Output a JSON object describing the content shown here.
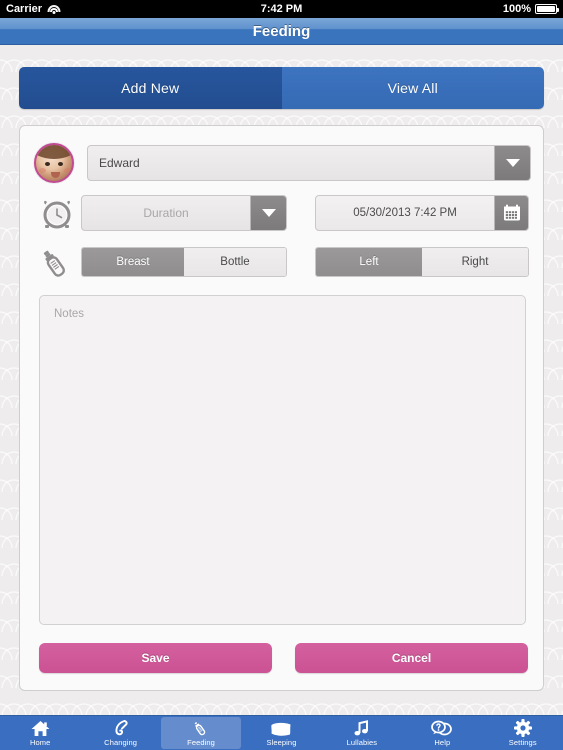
{
  "statusbar": {
    "carrier": "Carrier",
    "wifi_icon": "wifi-icon",
    "time": "7:42 PM",
    "battery_percent": "100%",
    "battery_icon": "battery-icon"
  },
  "navbar": {
    "title": "Feeding"
  },
  "segmented": {
    "tabs": [
      {
        "label": "Add New",
        "selected": true
      },
      {
        "label": "View All",
        "selected": false
      }
    ]
  },
  "form": {
    "baby": {
      "avatar_icon": "baby-avatar",
      "name": "Edward",
      "dropdown_icon": "chevron-down-icon"
    },
    "duration": {
      "clock_icon": "alarm-clock-icon",
      "placeholder": "Duration",
      "value": "",
      "dropdown_icon": "chevron-down-icon"
    },
    "datetime": {
      "value": "05/30/2013 7:42 PM",
      "calendar_icon": "calendar-icon"
    },
    "feed_type": {
      "bottle_icon": "baby-bottle-icon",
      "options": [
        {
          "label": "Breast",
          "selected": true
        },
        {
          "label": "Bottle",
          "selected": false
        }
      ]
    },
    "side": {
      "options": [
        {
          "label": "Left",
          "selected": true
        },
        {
          "label": "Right",
          "selected": false
        }
      ]
    },
    "notes": {
      "placeholder": "Notes",
      "value": ""
    },
    "actions": {
      "save_label": "Save",
      "cancel_label": "Cancel"
    }
  },
  "tabbar": {
    "items": [
      {
        "label": "Home",
        "icon": "house-icon",
        "active": false
      },
      {
        "label": "Changing",
        "icon": "safety-pin-icon",
        "active": false
      },
      {
        "label": "Feeding",
        "icon": "baby-bottle-icon",
        "active": true
      },
      {
        "label": "Sleeping",
        "icon": "pillow-icon",
        "active": false
      },
      {
        "label": "Lullabies",
        "icon": "music-note-icon",
        "active": false
      },
      {
        "label": "Help",
        "icon": "question-bubbles-icon",
        "active": false
      },
      {
        "label": "Settings",
        "icon": "gear-icon",
        "active": false
      }
    ]
  },
  "colors": {
    "accent_blue": "#3a6ec0",
    "nav_blue": "#3a74bd",
    "selected_segment": "#27569e",
    "pink_button": "#cb5293",
    "avatar_ring": "#c04a93",
    "toggle_on_gray": "#8f8d8d"
  }
}
